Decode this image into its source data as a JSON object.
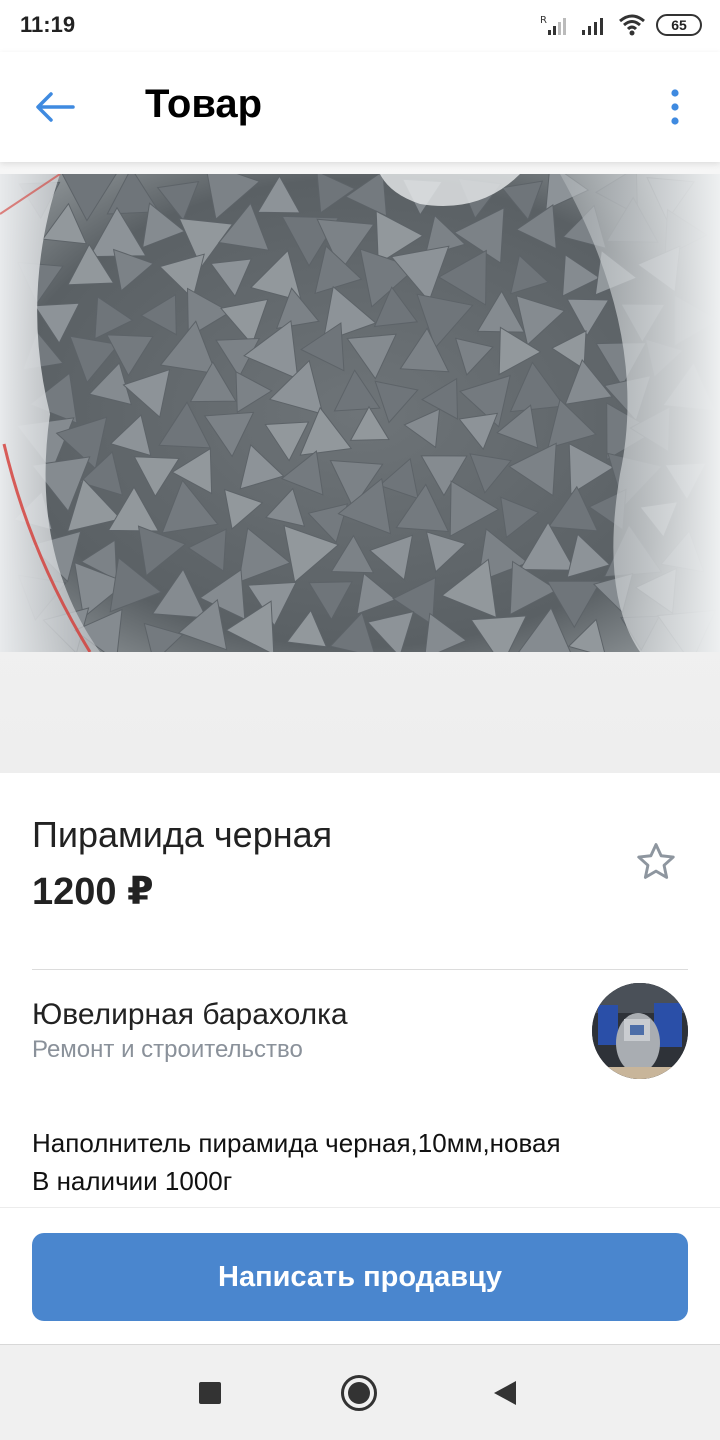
{
  "status_bar": {
    "time": "11:19",
    "battery": "65",
    "icons": [
      "signal-roaming-icon",
      "signal-icon",
      "wifi-icon",
      "battery-icon"
    ]
  },
  "header": {
    "title": "Товар",
    "back_icon": "arrow-left-icon",
    "menu_icon": "more-vertical-icon"
  },
  "product": {
    "image": "product-photo",
    "title": "Пирамида черная",
    "price": "1200 ₽",
    "favorite_icon": "star-outline-icon"
  },
  "seller": {
    "name": "Ювелирная барахолка",
    "category": "Ремонт и строительство",
    "avatar": "seller-avatar"
  },
  "description": {
    "line1": "Наполнитель пирамида черная,10мм,новая",
    "line2": "В наличии 1000г"
  },
  "actions": {
    "contact_label": "Написать продавцу"
  },
  "nav_bar": {
    "icons": [
      "recent-apps-icon",
      "home-icon",
      "back-icon"
    ]
  },
  "colors": {
    "accent": "#4a86ce",
    "back_arrow": "#3f8ae0",
    "secondary_text": "#8a919a",
    "star": "#8e969f"
  }
}
